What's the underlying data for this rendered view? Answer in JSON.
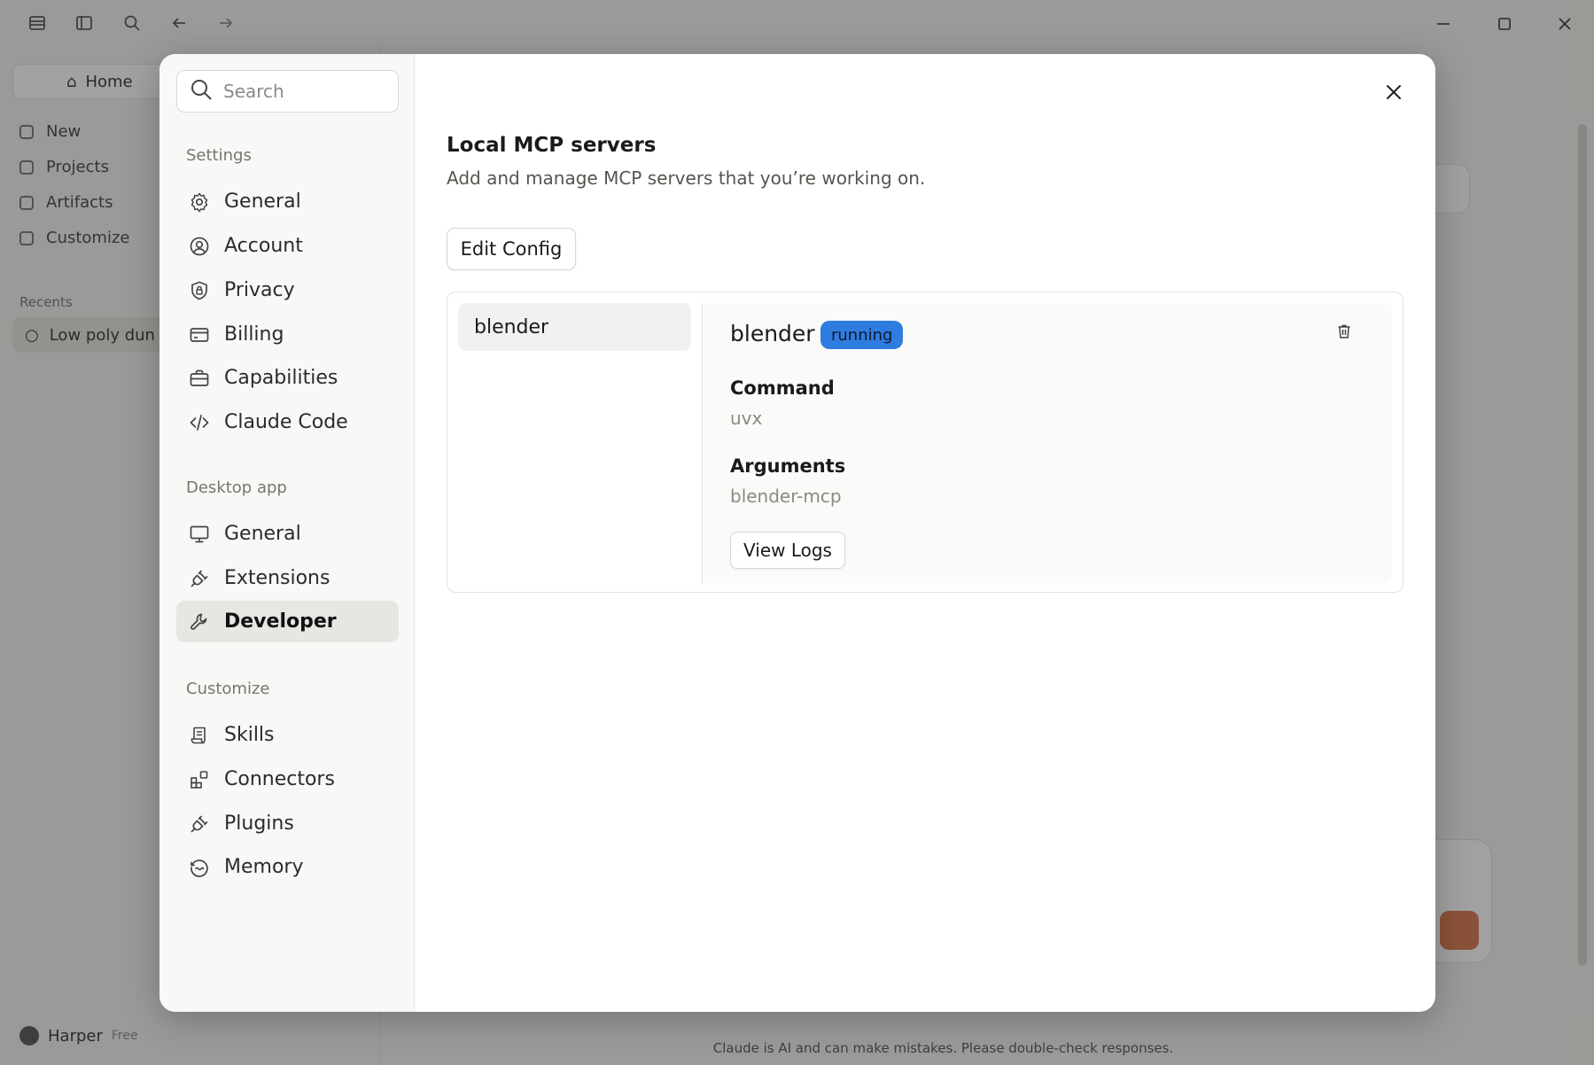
{
  "background": {
    "home_label": "Home",
    "rail_items": [
      "New",
      "Projects",
      "Artifacts",
      "Customize"
    ],
    "recents_label": "Recents",
    "recent_chat": "Low poly dun",
    "user_name": "Harper",
    "user_plan": "Free",
    "disclaimer": "Claude is AI and can make mistakes. Please double-check responses."
  },
  "search": {
    "placeholder": "Search",
    "value": ""
  },
  "sidebar": {
    "sections": [
      {
        "label": "Settings",
        "items": [
          {
            "label": "General",
            "icon": "gear-icon"
          },
          {
            "label": "Account",
            "icon": "user-circle-icon"
          },
          {
            "label": "Privacy",
            "icon": "shield-lock-icon"
          },
          {
            "label": "Billing",
            "icon": "credit-card-icon"
          },
          {
            "label": "Capabilities",
            "icon": "briefcase-icon"
          },
          {
            "label": "Claude Code",
            "icon": "code-icon"
          }
        ]
      },
      {
        "label": "Desktop app",
        "items": [
          {
            "label": "General",
            "icon": "monitor-icon"
          },
          {
            "label": "Extensions",
            "icon": "plug-icon"
          },
          {
            "label": "Developer",
            "icon": "wrench-icon",
            "active": true
          }
        ]
      },
      {
        "label": "Customize",
        "items": [
          {
            "label": "Skills",
            "icon": "scroll-icon"
          },
          {
            "label": "Connectors",
            "icon": "blocks-icon"
          },
          {
            "label": "Plugins",
            "icon": "plug-icon"
          },
          {
            "label": "Memory",
            "icon": "memory-icon"
          }
        ]
      }
    ]
  },
  "main": {
    "title": "Local MCP servers",
    "subtitle": "Add and manage MCP servers that you’re working on.",
    "edit_config_label": "Edit Config",
    "servers": [
      {
        "name": "blender"
      }
    ],
    "detail": {
      "name": "blender",
      "status": "running",
      "status_color": "#2f7ce0",
      "command_label": "Command",
      "command_value": "uvx",
      "arguments_label": "Arguments",
      "arguments_value": "blender-mcp",
      "view_logs_label": "View Logs"
    }
  }
}
